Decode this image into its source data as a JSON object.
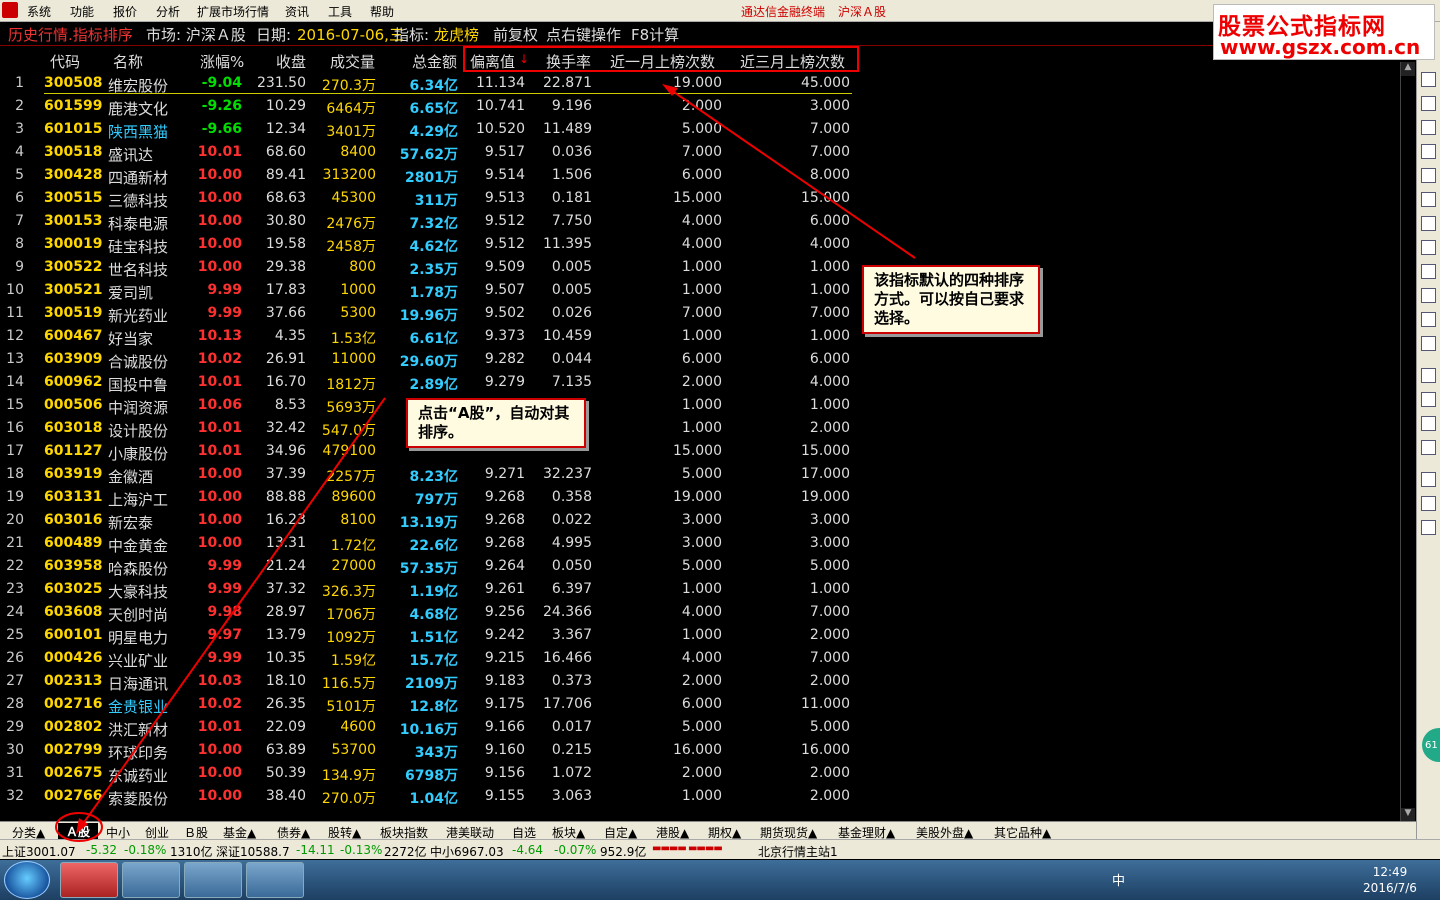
{
  "menu": {
    "items": [
      "系统",
      "功能",
      "报价",
      "分析",
      "扩展市场行情",
      "资讯",
      "工具",
      "帮助"
    ],
    "app_title": "通达信金融终端",
    "market_title": "沪深Ａ股"
  },
  "watermark": {
    "line1": "股票公式指标网",
    "line2": "www.gszx.com.cn"
  },
  "infobar": {
    "mode": "历史行情.指标排序",
    "market": "市场: 沪深Ａ股",
    "date_label": "日期:",
    "date_value": "2016-07-06,三",
    "indicator_label": "指标:",
    "indicator_value": "龙虎榜",
    "fq": "前复权",
    "tip": "点右键操作",
    "f8": "F8计算"
  },
  "columns": [
    "代码",
    "名称",
    "涨幅%",
    "收盘",
    "成交量",
    "总金额",
    "偏离值",
    "换手率",
    "近一月上榜次数",
    "近三月上榜次数"
  ],
  "sort_mark": "↓",
  "rows": [
    {
      "i": "1",
      "code": "300508",
      "name": "维宏股份",
      "chg": "-9.04",
      "close": "231.50",
      "vol": "270.3万",
      "amt": "6.34亿",
      "dev": "11.134",
      "turn": "22.871",
      "m1": "19.000",
      "m3": "45.000"
    },
    {
      "i": "2",
      "code": "601599",
      "name": "鹿港文化",
      "chg": "-9.26",
      "close": "10.29",
      "vol": "6464万",
      "amt": "6.65亿",
      "dev": "10.741",
      "turn": "9.196",
      "m1": "2.000",
      "m3": "3.000"
    },
    {
      "i": "3",
      "code": "601015",
      "name": "陕西黑猫",
      "chg": "-9.66",
      "close": "12.34",
      "vol": "3401万",
      "amt": "4.29亿",
      "dev": "10.520",
      "turn": "11.489",
      "m1": "5.000",
      "m3": "7.000"
    },
    {
      "i": "4",
      "code": "300518",
      "name": "盛讯达",
      "chg": "10.01",
      "close": "68.60",
      "vol": "8400",
      "amt": "57.62万",
      "dev": "9.517",
      "turn": "0.036",
      "m1": "7.000",
      "m3": "7.000"
    },
    {
      "i": "5",
      "code": "300428",
      "name": "四通新材",
      "chg": "10.00",
      "close": "89.41",
      "vol": "313200",
      "amt": "2801万",
      "dev": "9.514",
      "turn": "1.506",
      "m1": "6.000",
      "m3": "8.000"
    },
    {
      "i": "6",
      "code": "300515",
      "name": "三德科技",
      "chg": "10.00",
      "close": "68.63",
      "vol": "45300",
      "amt": "311万",
      "dev": "9.513",
      "turn": "0.181",
      "m1": "15.000",
      "m3": "15.000"
    },
    {
      "i": "7",
      "code": "300153",
      "name": "科泰电源",
      "chg": "10.00",
      "close": "30.80",
      "vol": "2476万",
      "amt": "7.32亿",
      "dev": "9.512",
      "turn": "7.750",
      "m1": "4.000",
      "m3": "6.000"
    },
    {
      "i": "8",
      "code": "300019",
      "name": "硅宝科技",
      "chg": "10.00",
      "close": "19.58",
      "vol": "2458万",
      "amt": "4.62亿",
      "dev": "9.512",
      "turn": "11.395",
      "m1": "4.000",
      "m3": "4.000"
    },
    {
      "i": "9",
      "code": "300522",
      "name": "世名科技",
      "chg": "10.00",
      "close": "29.38",
      "vol": "800",
      "amt": "2.35万",
      "dev": "9.509",
      "turn": "0.005",
      "m1": "1.000",
      "m3": "1.000"
    },
    {
      "i": "10",
      "code": "300521",
      "name": "爱司凯",
      "chg": "9.99",
      "close": "17.83",
      "vol": "1000",
      "amt": "1.78万",
      "dev": "9.507",
      "turn": "0.005",
      "m1": "1.000",
      "m3": "1.000"
    },
    {
      "i": "11",
      "code": "300519",
      "name": "新光药业",
      "chg": "9.99",
      "close": "37.66",
      "vol": "5300",
      "amt": "19.96万",
      "dev": "9.502",
      "turn": "0.026",
      "m1": "7.000",
      "m3": "7.000"
    },
    {
      "i": "12",
      "code": "600467",
      "name": "好当家",
      "chg": "10.13",
      "close": "4.35",
      "vol": "1.53亿",
      "amt": "6.61亿",
      "dev": "9.373",
      "turn": "10.459",
      "m1": "1.000",
      "m3": "1.000"
    },
    {
      "i": "13",
      "code": "603909",
      "name": "合诚股份",
      "chg": "10.02",
      "close": "26.91",
      "vol": "11000",
      "amt": "29.60万",
      "dev": "9.282",
      "turn": "0.044",
      "m1": "6.000",
      "m3": "6.000"
    },
    {
      "i": "14",
      "code": "600962",
      "name": "国投中鲁",
      "chg": "10.01",
      "close": "16.70",
      "vol": "1812万",
      "amt": "2.89亿",
      "dev": "9.279",
      "turn": "7.135",
      "m1": "2.000",
      "m3": "4.000"
    },
    {
      "i": "15",
      "code": "000506",
      "name": "中润资源",
      "chg": "10.06",
      "close": "8.53",
      "vol": "5693万",
      "amt": "",
      "dev": "",
      "turn": "",
      "m1": "1.000",
      "m3": "1.000"
    },
    {
      "i": "16",
      "code": "603018",
      "name": "设计股份",
      "chg": "10.01",
      "close": "32.42",
      "vol": "547.0万",
      "amt": "",
      "dev": "",
      "turn": "",
      "m1": "1.000",
      "m3": "2.000"
    },
    {
      "i": "17",
      "code": "601127",
      "name": "小康股份",
      "chg": "10.01",
      "close": "34.96",
      "vol": "479100",
      "amt": "",
      "dev": "",
      "turn": "",
      "m1": "15.000",
      "m3": "15.000"
    },
    {
      "i": "18",
      "code": "603919",
      "name": "金徽酒",
      "chg": "10.00",
      "close": "37.39",
      "vol": "2257万",
      "amt": "8.23亿",
      "dev": "9.271",
      "turn": "32.237",
      "m1": "5.000",
      "m3": "17.000"
    },
    {
      "i": "19",
      "code": "603131",
      "name": "上海沪工",
      "chg": "10.00",
      "close": "88.88",
      "vol": "89600",
      "amt": "797万",
      "dev": "9.268",
      "turn": "0.358",
      "m1": "19.000",
      "m3": "19.000"
    },
    {
      "i": "20",
      "code": "603016",
      "name": "新宏泰",
      "chg": "10.00",
      "close": "16.23",
      "vol": "8100",
      "amt": "13.19万",
      "dev": "9.268",
      "turn": "0.022",
      "m1": "3.000",
      "m3": "3.000"
    },
    {
      "i": "21",
      "code": "600489",
      "name": "中金黄金",
      "chg": "10.00",
      "close": "13.31",
      "vol": "1.72亿",
      "amt": "22.6亿",
      "dev": "9.268",
      "turn": "4.995",
      "m1": "3.000",
      "m3": "3.000"
    },
    {
      "i": "22",
      "code": "603958",
      "name": "哈森股份",
      "chg": "9.99",
      "close": "21.24",
      "vol": "27000",
      "amt": "57.35万",
      "dev": "9.264",
      "turn": "0.050",
      "m1": "5.000",
      "m3": "5.000"
    },
    {
      "i": "23",
      "code": "603025",
      "name": "大豪科技",
      "chg": "9.99",
      "close": "37.32",
      "vol": "326.3万",
      "amt": "1.19亿",
      "dev": "9.261",
      "turn": "6.397",
      "m1": "1.000",
      "m3": "1.000"
    },
    {
      "i": "24",
      "code": "603608",
      "name": "天创时尚",
      "chg": "9.98",
      "close": "28.97",
      "vol": "1706万",
      "amt": "4.68亿",
      "dev": "9.256",
      "turn": "24.366",
      "m1": "4.000",
      "m3": "7.000"
    },
    {
      "i": "25",
      "code": "600101",
      "name": "明星电力",
      "chg": "9.97",
      "close": "13.79",
      "vol": "1092万",
      "amt": "1.51亿",
      "dev": "9.242",
      "turn": "3.367",
      "m1": "1.000",
      "m3": "2.000"
    },
    {
      "i": "26",
      "code": "000426",
      "name": "兴业矿业",
      "chg": "9.99",
      "close": "10.35",
      "vol": "1.59亿",
      "amt": "15.7亿",
      "dev": "9.215",
      "turn": "16.466",
      "m1": "4.000",
      "m3": "7.000"
    },
    {
      "i": "27",
      "code": "002313",
      "name": "日海通讯",
      "chg": "10.03",
      "close": "18.10",
      "vol": "116.5万",
      "amt": "2109万",
      "dev": "9.183",
      "turn": "0.373",
      "m1": "2.000",
      "m3": "2.000"
    },
    {
      "i": "28",
      "code": "002716",
      "name": "金贵银业",
      "chg": "10.02",
      "close": "26.35",
      "vol": "5101万",
      "amt": "12.8亿",
      "dev": "9.175",
      "turn": "17.706",
      "m1": "6.000",
      "m3": "11.000"
    },
    {
      "i": "29",
      "code": "002802",
      "name": "洪汇新材",
      "chg": "10.01",
      "close": "22.09",
      "vol": "4600",
      "amt": "10.16万",
      "dev": "9.166",
      "turn": "0.017",
      "m1": "5.000",
      "m3": "5.000"
    },
    {
      "i": "30",
      "code": "002799",
      "name": "环球印务",
      "chg": "10.00",
      "close": "63.89",
      "vol": "53700",
      "amt": "343万",
      "dev": "9.160",
      "turn": "0.215",
      "m1": "16.000",
      "m3": "16.000"
    },
    {
      "i": "31",
      "code": "002675",
      "name": "东诚药业",
      "chg": "10.00",
      "close": "50.39",
      "vol": "134.9万",
      "amt": "6798万",
      "dev": "9.156",
      "turn": "1.072",
      "m1": "2.000",
      "m3": "2.000"
    },
    {
      "i": "32",
      "code": "002766",
      "name": "索菱股份",
      "chg": "10.00",
      "close": "38.40",
      "vol": "270.0万",
      "amt": "1.04亿",
      "dev": "9.155",
      "turn": "3.063",
      "m1": "1.000",
      "m3": "2.000"
    }
  ],
  "callouts": {
    "sort_note": "该指标默认的四种排序方式。可以按自己要求选择。",
    "ashare_note": "点击“A股”，自动对其排序。"
  },
  "tabs": {
    "active": "Ａ股",
    "items": [
      "分类▲",
      "中小",
      "创业",
      "Ｂ股",
      "基金▲",
      "债券▲",
      "股转▲",
      "板块指数",
      "港美联动",
      "自选",
      "板块▲",
      "自定▲",
      "港股▲",
      "期权▲",
      "期货现货▲",
      "基金理财▲",
      "美股外盘▲",
      "其它品种▲"
    ]
  },
  "status": {
    "sh": "上证3001.07",
    "sh_chg": "-5.32",
    "sh_pct": "-0.18%",
    "sh_amt": "1310亿",
    "sz": "深证10588.7",
    "sz_chg": "-14.11",
    "sz_pct": "-0.13%",
    "sz_amt": "2272亿",
    "zx": "中小6967.03",
    "zx_chg": "-4.64",
    "zx_pct": "-0.07%",
    "zx_amt": "952.9亿",
    "server": "北京行情主站1"
  },
  "taskbar": {
    "time": "12:49",
    "date": "2016/7/6",
    "ime": "中",
    "ball": "61"
  },
  "colors": {
    "up": "#ff3030",
    "down": "#00e000",
    "code": "#ffd700",
    "amount": "#33ccff",
    "highlight_name": "#33ccff"
  }
}
